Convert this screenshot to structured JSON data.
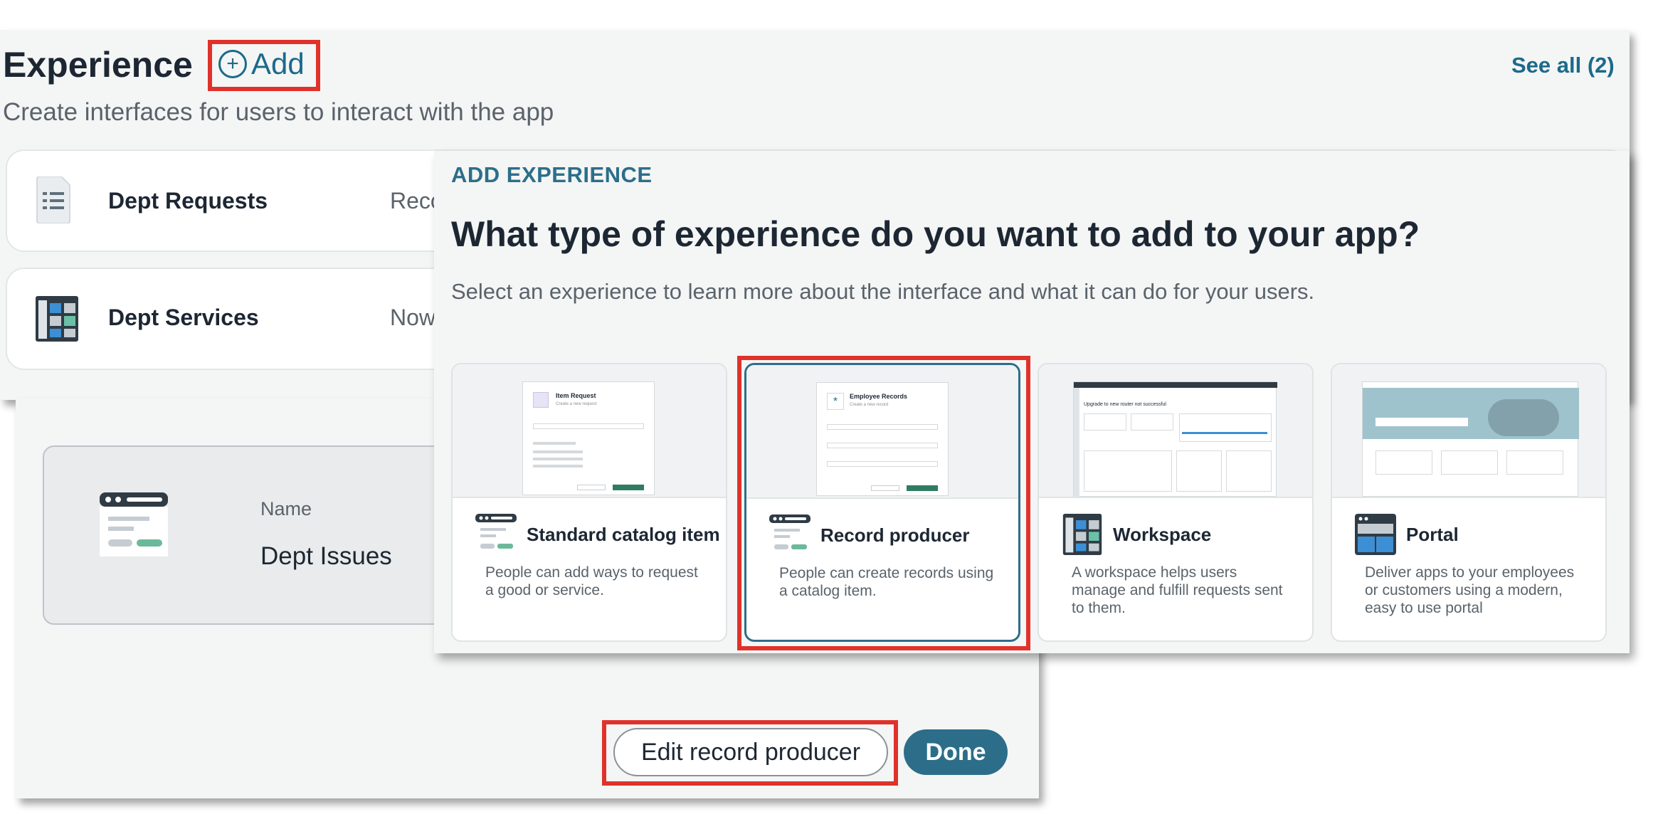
{
  "section": {
    "title": "Experience",
    "add_label": "Add",
    "see_all": "See all (2)",
    "subtitle": "Create interfaces for users to interact with the app"
  },
  "experiences": [
    {
      "name": "Dept Requests",
      "type": "Reco",
      "icon": "catalog-list-icon"
    },
    {
      "name": "Dept Services",
      "type": "Now",
      "icon": "workspace-grid-icon"
    }
  ],
  "detail": {
    "name_label": "Name",
    "name_value": "Dept Issues",
    "icon": "record-producer-icon"
  },
  "actions": {
    "edit": "Edit record producer",
    "done": "Done"
  },
  "modal": {
    "eyebrow": "ADD EXPERIENCE",
    "heading": "What type of experience do you want to add to your app?",
    "subtitle": "Select an experience to learn more about the interface and what it can do for your users.",
    "options": [
      {
        "title": "Standard catalog item",
        "desc": "People can add ways to request a good or service.",
        "icon": "catalog-item-icon",
        "preview_title": "Item Request",
        "preview_sub": "Create a new request"
      },
      {
        "title": "Record producer",
        "desc": "People can create records using a catalog item.",
        "icon": "record-producer-icon",
        "preview_title": "Employee Records",
        "preview_sub": "Create a new record",
        "selected": true
      },
      {
        "title": "Workspace",
        "desc": "A workspace helps users manage and fulfill requests sent to them.",
        "icon": "workspace-icon",
        "preview_title": "Upgrade to new router not successful"
      },
      {
        "title": "Portal",
        "desc": "Deliver apps to your employees or customers using a modern, easy to use portal",
        "icon": "portal-icon"
      }
    ]
  },
  "colors": {
    "accent": "#2c6e8a",
    "highlight": "#e0322a",
    "panel": "#f4f5f5"
  }
}
